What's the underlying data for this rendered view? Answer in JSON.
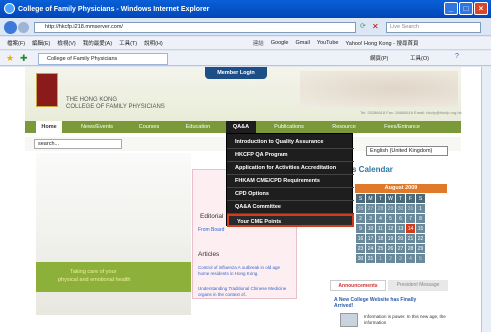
{
  "window": {
    "title": "College of Family Physicians - Windows Internet Explorer",
    "url": "http://hkcfp.i218.mmserver.com/",
    "search_placeholder": "Live Search",
    "tab_title": "College of Family Physicians"
  },
  "menu": [
    "檔案(F)",
    "編輯(E)",
    "檢視(V)",
    "我的最愛(A)",
    "工具(T)",
    "說明(H)"
  ],
  "favbar": {
    "link_label": "連結",
    "links": [
      "Google",
      "Gmail",
      "YouTube",
      "Yahoo! Hong Kong - 搜尋首頁"
    ],
    "cmd": [
      "網頁(P)",
      "工具(O)"
    ]
  },
  "site": {
    "member_login": "Member Login",
    "logo_line1": "THE HONG KONG",
    "logo_line2": "COLLEGE OF FAMILY PHYSICIANS",
    "contact": "Tel: 25286618  Fax: 28660616  Email: hkcfp@hkcfp.org.hk",
    "nav": [
      "Home",
      "News/Events",
      "Courses",
      "Education",
      "QA&A",
      "Publications",
      "Resource",
      "Fees/Entrance"
    ],
    "search_value": "search...",
    "language": "English (United Kingdom)",
    "dropdown": [
      "Introduction to Quality Assurance",
      "HKCFP QA Program",
      "Application for Activities Accreditation",
      "FHKAM CME/CPD Requirements",
      "CPD Options",
      "QA&A Committee",
      "Your CME Points"
    ],
    "hero_text1": "Taking care of your",
    "hero_text2": "physical and emotional health",
    "editorial": "Editorial",
    "editorial_link": "From Board",
    "articles": "Articles",
    "article1": "Control of influenza A outbreak in old age home residents in Hong Kong.",
    "article2": "Understanding Traditional Chinese Medicine organs in the context of..",
    "calendar_title": "s Calendar",
    "calendar_month": "August 2009",
    "cal_days": [
      "S",
      "M",
      "T",
      "W",
      "T",
      "F",
      "S"
    ],
    "cal_rows": [
      [
        "26",
        "27",
        "28",
        "29",
        "30",
        "31",
        "1"
      ],
      [
        "2",
        "3",
        "4",
        "5",
        "6",
        "7",
        "8"
      ],
      [
        "9",
        "10",
        "11",
        "12",
        "13",
        "14",
        "15"
      ],
      [
        "16",
        "17",
        "18",
        "19",
        "20",
        "21",
        "22"
      ],
      [
        "23",
        "24",
        "25",
        "26",
        "27",
        "28",
        "29"
      ],
      [
        "30",
        "31",
        "1",
        "2",
        "3",
        "4",
        "5"
      ]
    ],
    "tab_announcements": "Announcements",
    "tab_president": "President Message",
    "announce_title": "A New College Website has Finally Arrived!",
    "announce_text": "Information is power. In this new age, the information"
  },
  "colors": {
    "nav_green": "#7a9a3a",
    "dropdown_bg": "#1e1e1e",
    "highlight": "#d23c1c"
  }
}
